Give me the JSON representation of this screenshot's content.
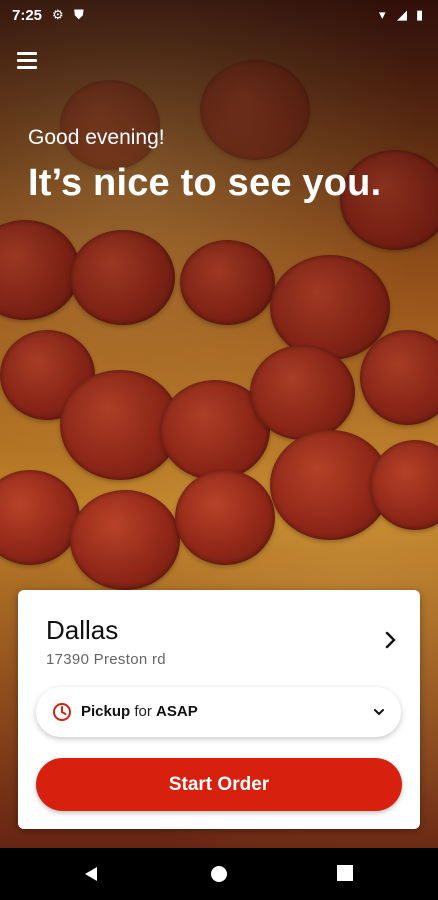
{
  "status_bar": {
    "time": "7:25"
  },
  "header": {
    "greeting": "Good evening!",
    "headline": "It’s nice to see you."
  },
  "location": {
    "city": "Dallas",
    "address": "17390 Preston rd"
  },
  "order_mode": {
    "mode": "Pickup",
    "connector": "for",
    "time": "ASAP"
  },
  "actions": {
    "start_order": "Start Order"
  },
  "colors": {
    "accent": "#d8200f",
    "card_bg": "#ffffff"
  },
  "icons": [
    "menu-icon",
    "chevron-right-icon",
    "clock-icon",
    "chevron-down-icon",
    "back-icon",
    "home-icon",
    "recents-icon"
  ]
}
